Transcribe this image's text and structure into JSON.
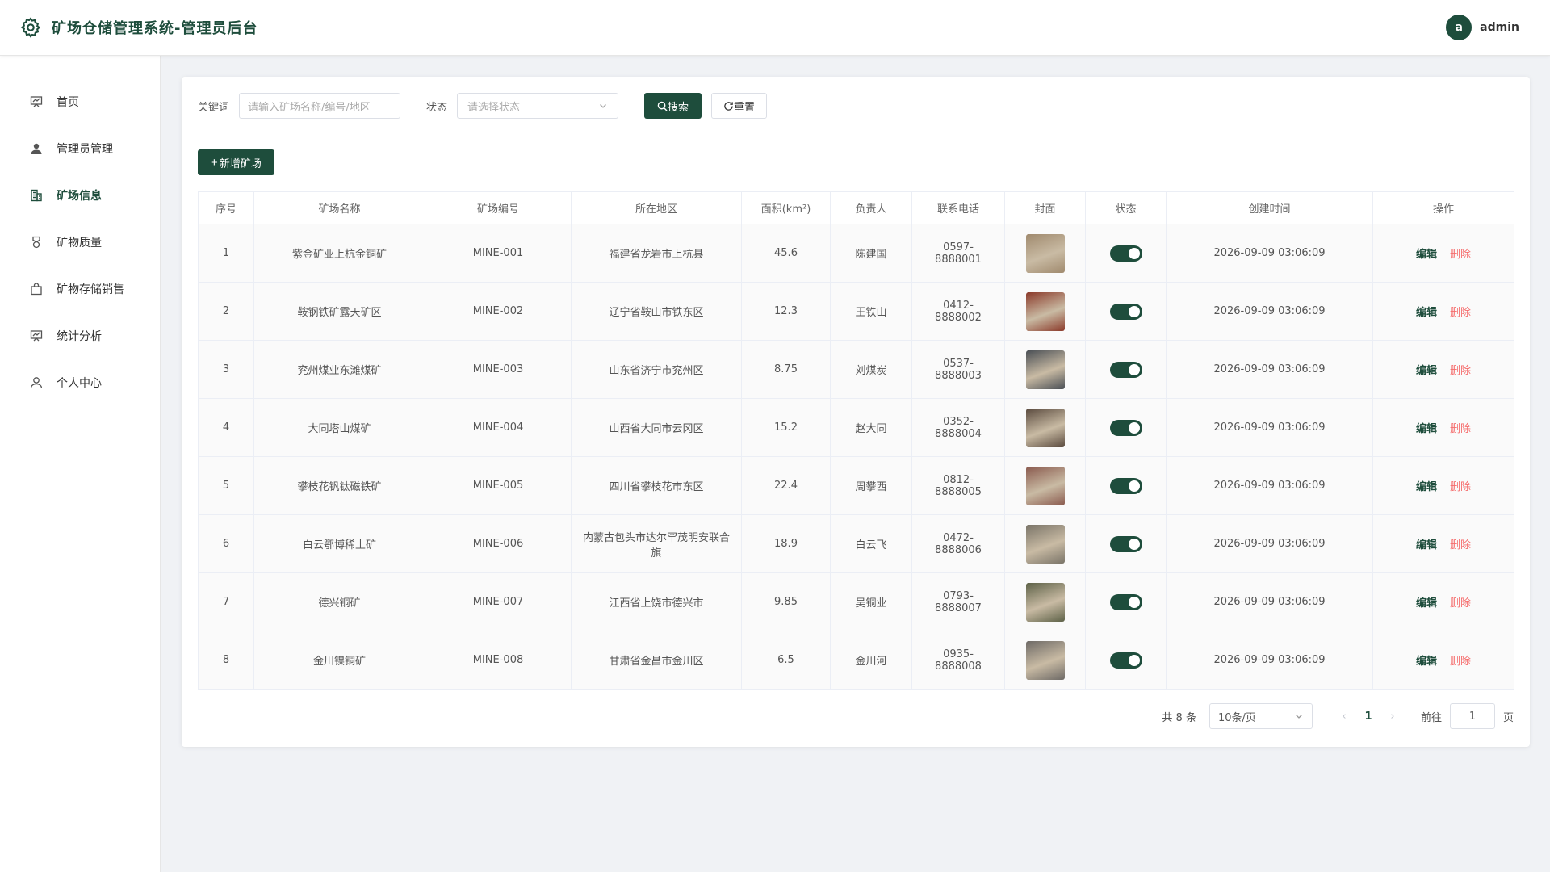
{
  "header": {
    "title": "矿场仓储管理系统-管理员后台",
    "user": {
      "avatar_letter": "a",
      "name": "admin"
    }
  },
  "sidebar": {
    "items": [
      {
        "label": "首页",
        "icon": "dashboard-icon",
        "active": false
      },
      {
        "label": "管理员管理",
        "icon": "user-icon",
        "active": false
      },
      {
        "label": "矿场信息",
        "icon": "building-icon",
        "active": true
      },
      {
        "label": "矿物质量",
        "icon": "medal-icon",
        "active": false
      },
      {
        "label": "矿物存储销售",
        "icon": "bag-icon",
        "active": false
      },
      {
        "label": "统计分析",
        "icon": "chart-icon",
        "active": false
      },
      {
        "label": "个人中心",
        "icon": "person-icon",
        "active": false
      }
    ]
  },
  "search": {
    "keyword_label": "关键词",
    "keyword_placeholder": "请输入矿场名称/编号/地区",
    "status_label": "状态",
    "status_placeholder": "请选择状态",
    "search_label": "搜索",
    "reset_label": "重置",
    "add_label": "新增矿场"
  },
  "table": {
    "columns": [
      "序号",
      "矿场名称",
      "矿场编号",
      "所在地区",
      "面积(km²)",
      "负责人",
      "联系电话",
      "封面",
      "状态",
      "创建时间",
      "操作"
    ],
    "rows": [
      {
        "no": "1",
        "name": "紫金矿业上杭金铜矿",
        "code": "MINE-001",
        "region": "福建省龙岩市上杭县",
        "area": "45.6",
        "manager": "陈建国",
        "phone": "0597-8888001",
        "cover_color": "#a08a6e",
        "status": true,
        "created": "2026-09-09 03:06:09"
      },
      {
        "no": "2",
        "name": "鞍钢铁矿露天矿区",
        "code": "MINE-002",
        "region": "辽宁省鞍山市铁东区",
        "area": "12.3",
        "manager": "王铁山",
        "phone": "0412-8888002",
        "cover_color": "#8b3a2a",
        "status": true,
        "created": "2026-09-09 03:06:09"
      },
      {
        "no": "3",
        "name": "兖州煤业东滩煤矿",
        "code": "MINE-003",
        "region": "山东省济宁市兖州区",
        "area": "8.75",
        "manager": "刘煤炭",
        "phone": "0537-8888003",
        "cover_color": "#4a4f55",
        "status": true,
        "created": "2026-09-09 03:06:09"
      },
      {
        "no": "4",
        "name": "大同塔山煤矿",
        "code": "MINE-004",
        "region": "山西省大同市云冈区",
        "area": "15.2",
        "manager": "赵大同",
        "phone": "0352-8888004",
        "cover_color": "#5a4a3e",
        "status": true,
        "created": "2026-09-09 03:06:09"
      },
      {
        "no": "5",
        "name": "攀枝花钒钛磁铁矿",
        "code": "MINE-005",
        "region": "四川省攀枝花市东区",
        "area": "22.4",
        "manager": "周攀西",
        "phone": "0812-8888005",
        "cover_color": "#8a5a4e",
        "status": true,
        "created": "2026-09-09 03:06:09"
      },
      {
        "no": "6",
        "name": "白云鄂博稀土矿",
        "code": "MINE-006",
        "region": "内蒙古包头市达尔罕茂明安联合旗",
        "area": "18.9",
        "manager": "白云飞",
        "phone": "0472-8888006",
        "cover_color": "#7a7468",
        "status": true,
        "created": "2026-09-09 03:06:09"
      },
      {
        "no": "7",
        "name": "德兴铜矿",
        "code": "MINE-007",
        "region": "江西省上饶市德兴市",
        "area": "9.85",
        "manager": "吴铜业",
        "phone": "0793-8888007",
        "cover_color": "#5e6248",
        "status": true,
        "created": "2026-09-09 03:06:09"
      },
      {
        "no": "8",
        "name": "金川镍铜矿",
        "code": "MINE-008",
        "region": "甘肃省金昌市金川区",
        "area": "6.5",
        "manager": "金川河",
        "phone": "0935-8888008",
        "cover_color": "#6e6a66",
        "status": true,
        "created": "2026-09-09 03:06:09"
      }
    ],
    "edit_label": "编辑",
    "delete_label": "删除"
  },
  "pagination": {
    "total_text": "共 8 条",
    "page_size": "10条/页",
    "current_page": "1",
    "goto_label": "前往",
    "goto_value": "1",
    "page_suffix": "页"
  },
  "colors": {
    "primary": "#1e4d3c",
    "danger": "#f56c6c"
  }
}
